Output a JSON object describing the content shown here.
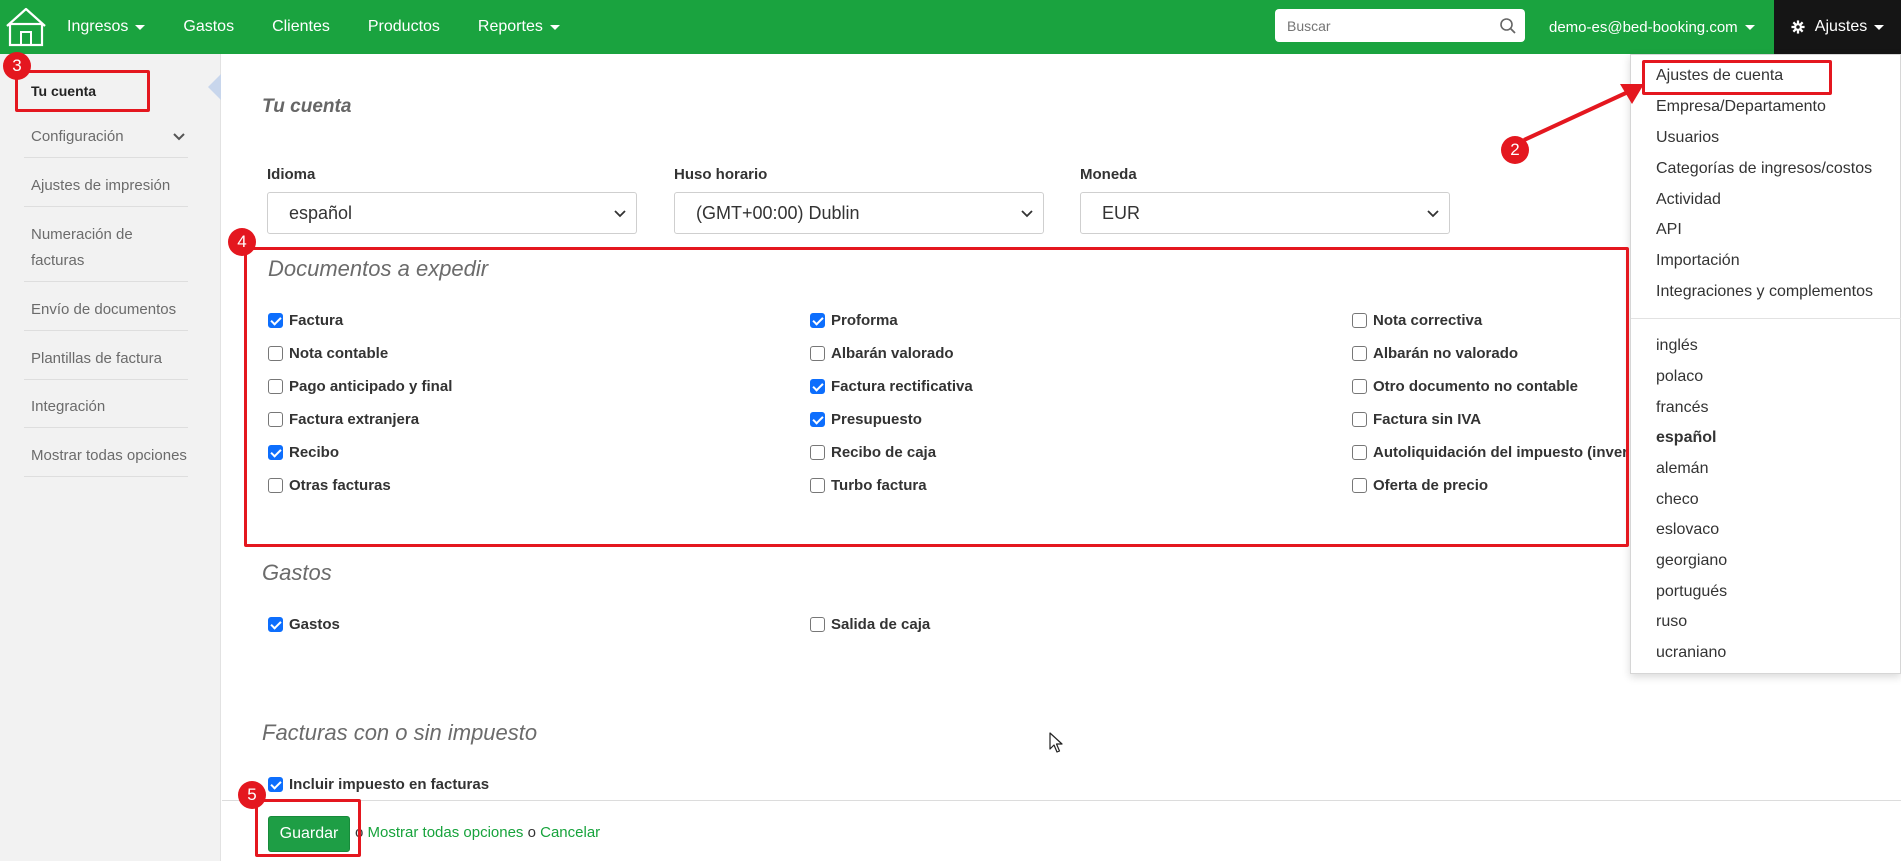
{
  "navbar": {
    "menu": [
      {
        "label": "Ingresos",
        "caret": true
      },
      {
        "label": "Gastos",
        "caret": false
      },
      {
        "label": "Clientes",
        "caret": false
      },
      {
        "label": "Productos",
        "caret": false
      },
      {
        "label": "Reportes",
        "caret": true
      }
    ],
    "search_placeholder": "Buscar",
    "user": "demo-es@bed-booking.com",
    "settings_label": "Ajustes",
    "brand_color": "#1aa33f"
  },
  "sidebar": {
    "items": [
      {
        "label": "Tu cuenta",
        "active": true
      },
      {
        "label": "Configuración",
        "chevron": true
      },
      {
        "label": "Ajustes de impresión"
      },
      {
        "label": "Numeración de facturas"
      },
      {
        "label": "Envío de documentos"
      },
      {
        "label": "Plantillas de factura"
      },
      {
        "label": "Integración"
      },
      {
        "label": "Mostrar todas opciones"
      }
    ]
  },
  "main": {
    "title": "Tu cuenta",
    "fields": [
      {
        "label": "Idioma",
        "value": "español"
      },
      {
        "label": "Huso horario",
        "value": "(GMT+00:00) Dublin"
      },
      {
        "label": "Moneda",
        "value": "EUR"
      }
    ],
    "documents": {
      "title": "Documentos a expedir",
      "items": [
        {
          "label": "Factura",
          "checked": true
        },
        {
          "label": "Proforma",
          "checked": true
        },
        {
          "label": "Nota correctiva",
          "checked": false
        },
        {
          "label": "Nota contable",
          "checked": false
        },
        {
          "label": "Albarán valorado",
          "checked": false
        },
        {
          "label": "Albarán no valorado",
          "checked": false
        },
        {
          "label": "Pago anticipado y final",
          "checked": false
        },
        {
          "label": "Factura rectificativa",
          "checked": true
        },
        {
          "label": "Otro documento no contable",
          "checked": false
        },
        {
          "label": "Factura extranjera",
          "checked": false
        },
        {
          "label": "Presupuesto",
          "checked": true
        },
        {
          "label": "Factura sin IVA",
          "checked": false
        },
        {
          "label": "Recibo",
          "checked": true
        },
        {
          "label": "Recibo de caja",
          "checked": false
        },
        {
          "label": "Autoliquidación del impuesto (inver",
          "checked": false
        },
        {
          "label": "Otras facturas",
          "checked": false
        },
        {
          "label": "Turbo factura",
          "checked": false
        },
        {
          "label": "Oferta de precio",
          "checked": false
        }
      ]
    },
    "expenses": {
      "title": "Gastos",
      "items": [
        {
          "label": "Gastos",
          "checked": true
        },
        {
          "label": "Salida de caja",
          "checked": false
        }
      ]
    },
    "tax": {
      "title": "Facturas con o sin impuesto",
      "items": [
        {
          "label": "Incluir impuesto en facturas",
          "checked": true
        }
      ]
    }
  },
  "footer": {
    "save_label": "Guardar",
    "sep1": "o",
    "show_all_label": "Mostrar todas opciones",
    "sep2": "o",
    "cancel_label": "Cancelar"
  },
  "dropdown": {
    "settings_items": [
      "Ajustes de cuenta",
      "Empresa/Departamento",
      "Usuarios",
      "Categorías de ingresos/costos",
      "Actividad",
      "API",
      "Importación",
      "Integraciones y complementos"
    ],
    "languages": [
      {
        "label": "inglés"
      },
      {
        "label": "polaco"
      },
      {
        "label": "francés"
      },
      {
        "label": "español",
        "current": true
      },
      {
        "label": "alemán"
      },
      {
        "label": "checo"
      },
      {
        "label": "eslovaco"
      },
      {
        "label": "georgiano"
      },
      {
        "label": "portugués"
      },
      {
        "label": "ruso"
      },
      {
        "label": "ucraniano"
      }
    ]
  },
  "annotations": {
    "steps": [
      "2",
      "3",
      "4",
      "5"
    ],
    "color": "#e4171f"
  }
}
